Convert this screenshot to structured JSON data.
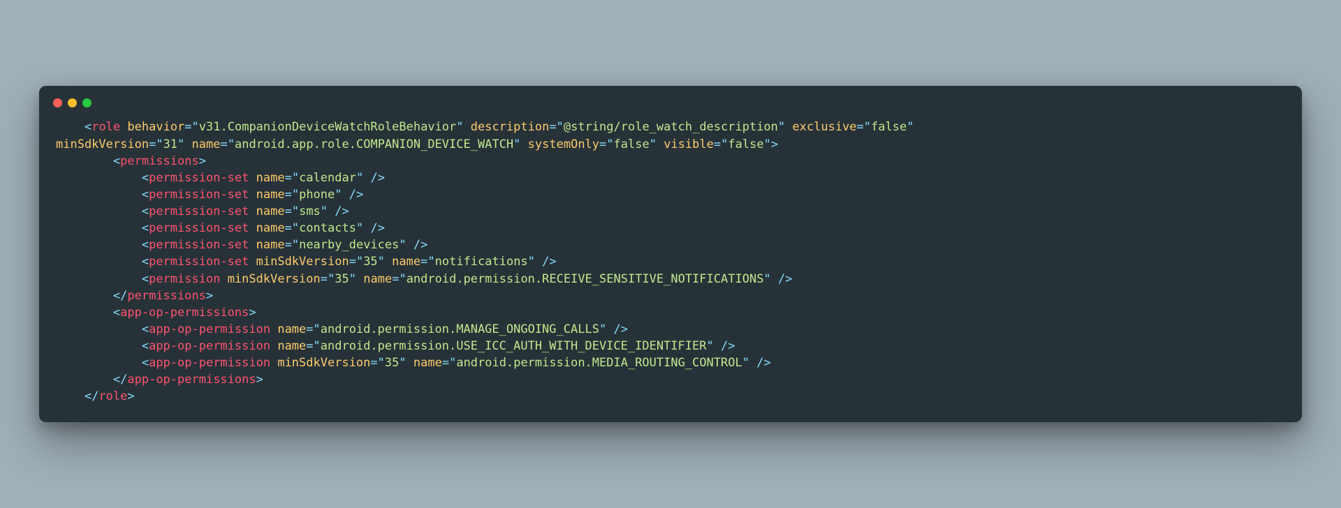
{
  "code": {
    "tokens": [
      {
        "cls": "txt",
        "t": "    "
      },
      {
        "cls": "op",
        "t": "<"
      },
      {
        "cls": "tag",
        "t": "role"
      },
      {
        "cls": "txt",
        "t": " "
      },
      {
        "cls": "attr",
        "t": "behavior"
      },
      {
        "cls": "op",
        "t": "="
      },
      {
        "cls": "op",
        "t": "\""
      },
      {
        "cls": "str",
        "t": "v31.CompanionDeviceWatchRoleBehavior"
      },
      {
        "cls": "op",
        "t": "\""
      },
      {
        "cls": "txt",
        "t": " "
      },
      {
        "cls": "attr",
        "t": "description"
      },
      {
        "cls": "op",
        "t": "="
      },
      {
        "cls": "op",
        "t": "\""
      },
      {
        "cls": "str",
        "t": "@string/role_watch_description"
      },
      {
        "cls": "op",
        "t": "\""
      },
      {
        "cls": "txt",
        "t": " "
      },
      {
        "cls": "attr",
        "t": "exclusive"
      },
      {
        "cls": "op",
        "t": "="
      },
      {
        "cls": "op",
        "t": "\""
      },
      {
        "cls": "str",
        "t": "false"
      },
      {
        "cls": "op",
        "t": "\""
      },
      {
        "cls": "txt",
        "t": " \n"
      },
      {
        "cls": "attr",
        "t": "minSdkVersion"
      },
      {
        "cls": "op",
        "t": "="
      },
      {
        "cls": "op",
        "t": "\""
      },
      {
        "cls": "str",
        "t": "31"
      },
      {
        "cls": "op",
        "t": "\""
      },
      {
        "cls": "txt",
        "t": " "
      },
      {
        "cls": "attr",
        "t": "name"
      },
      {
        "cls": "op",
        "t": "="
      },
      {
        "cls": "op",
        "t": "\""
      },
      {
        "cls": "str",
        "t": "android.app.role.COMPANION_DEVICE_WATCH"
      },
      {
        "cls": "op",
        "t": "\""
      },
      {
        "cls": "txt",
        "t": " "
      },
      {
        "cls": "attr",
        "t": "systemOnly"
      },
      {
        "cls": "op",
        "t": "="
      },
      {
        "cls": "op",
        "t": "\""
      },
      {
        "cls": "str",
        "t": "false"
      },
      {
        "cls": "op",
        "t": "\""
      },
      {
        "cls": "txt",
        "t": " "
      },
      {
        "cls": "attr",
        "t": "visible"
      },
      {
        "cls": "op",
        "t": "="
      },
      {
        "cls": "op",
        "t": "\""
      },
      {
        "cls": "str",
        "t": "false"
      },
      {
        "cls": "op",
        "t": "\""
      },
      {
        "cls": "op",
        "t": ">"
      },
      {
        "cls": "txt",
        "t": "\n"
      },
      {
        "cls": "txt",
        "t": "        "
      },
      {
        "cls": "op",
        "t": "<"
      },
      {
        "cls": "tag",
        "t": "permissions"
      },
      {
        "cls": "op",
        "t": ">"
      },
      {
        "cls": "txt",
        "t": "\n"
      },
      {
        "cls": "txt",
        "t": "            "
      },
      {
        "cls": "op",
        "t": "<"
      },
      {
        "cls": "tag",
        "t": "permission-set"
      },
      {
        "cls": "txt",
        "t": " "
      },
      {
        "cls": "attr",
        "t": "name"
      },
      {
        "cls": "op",
        "t": "="
      },
      {
        "cls": "op",
        "t": "\""
      },
      {
        "cls": "str",
        "t": "calendar"
      },
      {
        "cls": "op",
        "t": "\""
      },
      {
        "cls": "txt",
        "t": " "
      },
      {
        "cls": "op",
        "t": "/>"
      },
      {
        "cls": "txt",
        "t": "\n"
      },
      {
        "cls": "txt",
        "t": "            "
      },
      {
        "cls": "op",
        "t": "<"
      },
      {
        "cls": "tag",
        "t": "permission-set"
      },
      {
        "cls": "txt",
        "t": " "
      },
      {
        "cls": "attr",
        "t": "name"
      },
      {
        "cls": "op",
        "t": "="
      },
      {
        "cls": "op",
        "t": "\""
      },
      {
        "cls": "str",
        "t": "phone"
      },
      {
        "cls": "op",
        "t": "\""
      },
      {
        "cls": "txt",
        "t": " "
      },
      {
        "cls": "op",
        "t": "/>"
      },
      {
        "cls": "txt",
        "t": "\n"
      },
      {
        "cls": "txt",
        "t": "            "
      },
      {
        "cls": "op",
        "t": "<"
      },
      {
        "cls": "tag",
        "t": "permission-set"
      },
      {
        "cls": "txt",
        "t": " "
      },
      {
        "cls": "attr",
        "t": "name"
      },
      {
        "cls": "op",
        "t": "="
      },
      {
        "cls": "op",
        "t": "\""
      },
      {
        "cls": "str",
        "t": "sms"
      },
      {
        "cls": "op",
        "t": "\""
      },
      {
        "cls": "txt",
        "t": " "
      },
      {
        "cls": "op",
        "t": "/>"
      },
      {
        "cls": "txt",
        "t": "\n"
      },
      {
        "cls": "txt",
        "t": "            "
      },
      {
        "cls": "op",
        "t": "<"
      },
      {
        "cls": "tag",
        "t": "permission-set"
      },
      {
        "cls": "txt",
        "t": " "
      },
      {
        "cls": "attr",
        "t": "name"
      },
      {
        "cls": "op",
        "t": "="
      },
      {
        "cls": "op",
        "t": "\""
      },
      {
        "cls": "str",
        "t": "contacts"
      },
      {
        "cls": "op",
        "t": "\""
      },
      {
        "cls": "txt",
        "t": " "
      },
      {
        "cls": "op",
        "t": "/>"
      },
      {
        "cls": "txt",
        "t": "\n"
      },
      {
        "cls": "txt",
        "t": "            "
      },
      {
        "cls": "op",
        "t": "<"
      },
      {
        "cls": "tag",
        "t": "permission-set"
      },
      {
        "cls": "txt",
        "t": " "
      },
      {
        "cls": "attr",
        "t": "name"
      },
      {
        "cls": "op",
        "t": "="
      },
      {
        "cls": "op",
        "t": "\""
      },
      {
        "cls": "str",
        "t": "nearby_devices"
      },
      {
        "cls": "op",
        "t": "\""
      },
      {
        "cls": "txt",
        "t": " "
      },
      {
        "cls": "op",
        "t": "/>"
      },
      {
        "cls": "txt",
        "t": "\n"
      },
      {
        "cls": "txt",
        "t": "            "
      },
      {
        "cls": "op",
        "t": "<"
      },
      {
        "cls": "tag",
        "t": "permission-set"
      },
      {
        "cls": "txt",
        "t": " "
      },
      {
        "cls": "attr",
        "t": "minSdkVersion"
      },
      {
        "cls": "op",
        "t": "="
      },
      {
        "cls": "op",
        "t": "\""
      },
      {
        "cls": "str",
        "t": "35"
      },
      {
        "cls": "op",
        "t": "\""
      },
      {
        "cls": "txt",
        "t": " "
      },
      {
        "cls": "attr",
        "t": "name"
      },
      {
        "cls": "op",
        "t": "="
      },
      {
        "cls": "op",
        "t": "\""
      },
      {
        "cls": "str",
        "t": "notifications"
      },
      {
        "cls": "op",
        "t": "\""
      },
      {
        "cls": "txt",
        "t": " "
      },
      {
        "cls": "op",
        "t": "/>"
      },
      {
        "cls": "txt",
        "t": "\n"
      },
      {
        "cls": "txt",
        "t": "            "
      },
      {
        "cls": "op",
        "t": "<"
      },
      {
        "cls": "tag",
        "t": "permission"
      },
      {
        "cls": "txt",
        "t": " "
      },
      {
        "cls": "attr",
        "t": "minSdkVersion"
      },
      {
        "cls": "op",
        "t": "="
      },
      {
        "cls": "op",
        "t": "\""
      },
      {
        "cls": "str",
        "t": "35"
      },
      {
        "cls": "op",
        "t": "\""
      },
      {
        "cls": "txt",
        "t": " "
      },
      {
        "cls": "attr",
        "t": "name"
      },
      {
        "cls": "op",
        "t": "="
      },
      {
        "cls": "op",
        "t": "\""
      },
      {
        "cls": "str",
        "t": "android.permission.RECEIVE_SENSITIVE_NOTIFICATIONS"
      },
      {
        "cls": "op",
        "t": "\""
      },
      {
        "cls": "txt",
        "t": " "
      },
      {
        "cls": "op",
        "t": "/>"
      },
      {
        "cls": "txt",
        "t": "\n"
      },
      {
        "cls": "txt",
        "t": "        "
      },
      {
        "cls": "op",
        "t": "</"
      },
      {
        "cls": "tag",
        "t": "permissions"
      },
      {
        "cls": "op",
        "t": ">"
      },
      {
        "cls": "txt",
        "t": "\n"
      },
      {
        "cls": "txt",
        "t": "        "
      },
      {
        "cls": "op",
        "t": "<"
      },
      {
        "cls": "tag",
        "t": "app-op-permissions"
      },
      {
        "cls": "op",
        "t": ">"
      },
      {
        "cls": "txt",
        "t": "\n"
      },
      {
        "cls": "txt",
        "t": "            "
      },
      {
        "cls": "op",
        "t": "<"
      },
      {
        "cls": "tag",
        "t": "app-op-permission"
      },
      {
        "cls": "txt",
        "t": " "
      },
      {
        "cls": "attr",
        "t": "name"
      },
      {
        "cls": "op",
        "t": "="
      },
      {
        "cls": "op",
        "t": "\""
      },
      {
        "cls": "str",
        "t": "android.permission.MANAGE_ONGOING_CALLS"
      },
      {
        "cls": "op",
        "t": "\""
      },
      {
        "cls": "txt",
        "t": " "
      },
      {
        "cls": "op",
        "t": "/>"
      },
      {
        "cls": "txt",
        "t": "\n"
      },
      {
        "cls": "txt",
        "t": "            "
      },
      {
        "cls": "op",
        "t": "<"
      },
      {
        "cls": "tag",
        "t": "app-op-permission"
      },
      {
        "cls": "txt",
        "t": " "
      },
      {
        "cls": "attr",
        "t": "name"
      },
      {
        "cls": "op",
        "t": "="
      },
      {
        "cls": "op",
        "t": "\""
      },
      {
        "cls": "str",
        "t": "android.permission.USE_ICC_AUTH_WITH_DEVICE_IDENTIFIER"
      },
      {
        "cls": "op",
        "t": "\""
      },
      {
        "cls": "txt",
        "t": " "
      },
      {
        "cls": "op",
        "t": "/>"
      },
      {
        "cls": "txt",
        "t": "\n"
      },
      {
        "cls": "txt",
        "t": "            "
      },
      {
        "cls": "op",
        "t": "<"
      },
      {
        "cls": "tag",
        "t": "app-op-permission"
      },
      {
        "cls": "txt",
        "t": " "
      },
      {
        "cls": "attr",
        "t": "minSdkVersion"
      },
      {
        "cls": "op",
        "t": "="
      },
      {
        "cls": "op",
        "t": "\""
      },
      {
        "cls": "str",
        "t": "35"
      },
      {
        "cls": "op",
        "t": "\""
      },
      {
        "cls": "txt",
        "t": " "
      },
      {
        "cls": "attr",
        "t": "name"
      },
      {
        "cls": "op",
        "t": "="
      },
      {
        "cls": "op",
        "t": "\""
      },
      {
        "cls": "str",
        "t": "android.permission.MEDIA_ROUTING_CONTROL"
      },
      {
        "cls": "op",
        "t": "\""
      },
      {
        "cls": "txt",
        "t": " "
      },
      {
        "cls": "op",
        "t": "/>"
      },
      {
        "cls": "txt",
        "t": "\n"
      },
      {
        "cls": "txt",
        "t": "        "
      },
      {
        "cls": "op",
        "t": "</"
      },
      {
        "cls": "tag",
        "t": "app-op-permissions"
      },
      {
        "cls": "op",
        "t": ">"
      },
      {
        "cls": "txt",
        "t": "\n"
      },
      {
        "cls": "txt",
        "t": "    "
      },
      {
        "cls": "op",
        "t": "</"
      },
      {
        "cls": "tag",
        "t": "role"
      },
      {
        "cls": "op",
        "t": ">"
      }
    ]
  }
}
